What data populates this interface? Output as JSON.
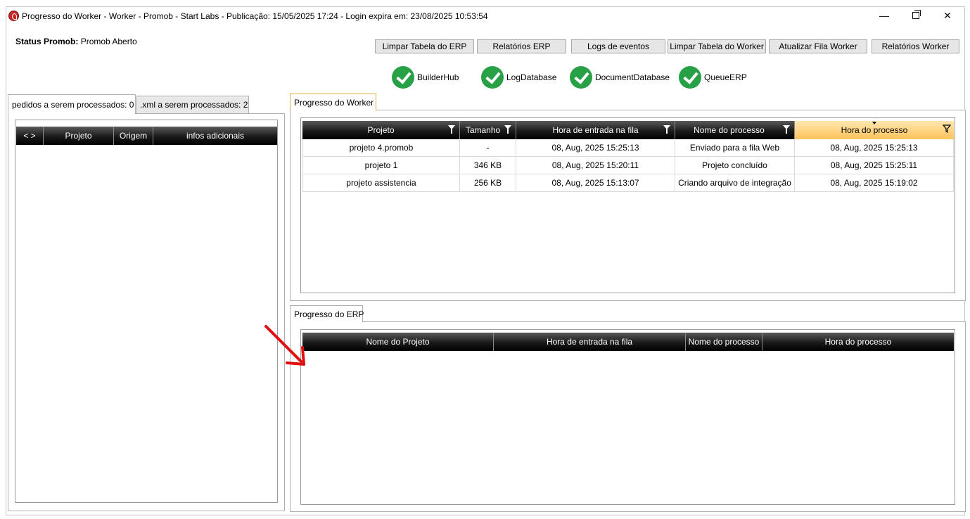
{
  "window": {
    "title": "Progresso do Worker  -  Worker - Promob  -  Start Labs  -  Publicação: 15/05/2025 17:24 - Login expira em: 23/08/2025 10:53:54",
    "minimize_glyph": "—",
    "close_glyph": "✕"
  },
  "status": {
    "label": "Status Promob:",
    "value": "Promob Aberto"
  },
  "toolbar": {
    "limpar_erp": "Limpar Tabela do ERP",
    "relatorios_erp": "Relatórios ERP",
    "logs_eventos": "Logs de eventos",
    "limpar_worker": "Limpar Tabela do Worker",
    "atualizar_fila": "Atualizar Fila Worker",
    "relatorios_worker": "Relatórios Worker"
  },
  "services": [
    {
      "name": "BuilderHub",
      "status": "ok",
      "icon": "check-circle-icon",
      "color": "#27a046"
    },
    {
      "name": "LogDatabase",
      "status": "ok",
      "icon": "check-circle-icon",
      "color": "#27a046"
    },
    {
      "name": "DocumentDatabase",
      "status": "ok",
      "icon": "check-circle-icon",
      "color": "#27a046"
    },
    {
      "name": "QueueERP",
      "status": "ok",
      "icon": "check-circle-icon",
      "color": "#27a046"
    }
  ],
  "left_panel": {
    "tabs": [
      {
        "label": "pedidos a serem processados: 0",
        "active": true
      },
      {
        "label": ".xml a serem processados: 2",
        "active": false
      }
    ],
    "columns": [
      "< >",
      "Projeto",
      "Origem",
      "infos adicionais"
    ],
    "rows": []
  },
  "worker_panel": {
    "tab_label": "Progresso do Worker",
    "columns": [
      "Projeto",
      "Tamanho",
      "Hora de entrada na fila",
      "Nome do processo",
      "Hora do processo"
    ],
    "sorted_column": "Hora do processo",
    "rows": [
      {
        "projeto": "projeto 4.promob",
        "tamanho": "-",
        "entrada": "08, Aug, 2025 15:25:13",
        "processo": "Enviado para a fila Web",
        "hora": "08, Aug, 2025 15:25:13"
      },
      {
        "projeto": "projeto 1",
        "tamanho": "346 KB",
        "entrada": "08, Aug, 2025 15:20:11",
        "processo": "Projeto concluído",
        "hora": "08, Aug, 2025 15:25:11"
      },
      {
        "projeto": "projeto assistencia",
        "tamanho": "256 KB",
        "entrada": "08, Aug, 2025 15:13:07",
        "processo": "Criando arquivo de integração",
        "hora": "08, Aug, 2025 15:19:02"
      }
    ]
  },
  "erp_panel": {
    "tab_label": "Progresso do ERP",
    "columns": [
      "Nome do Projeto",
      "Hora de entrada na fila",
      "Nome do processo",
      "Hora do processo"
    ],
    "rows": []
  },
  "colors": {
    "accent_tab": "#e2b13c",
    "sorted_header": "#ffc45a",
    "annotation_arrow": "#e01010"
  }
}
